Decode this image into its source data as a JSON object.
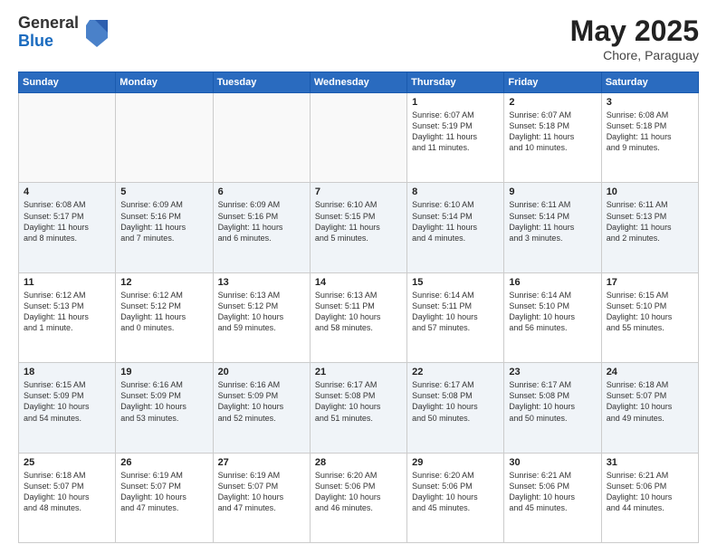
{
  "header": {
    "logo_general": "General",
    "logo_blue": "Blue",
    "month": "May 2025",
    "location": "Chore, Paraguay"
  },
  "weekdays": [
    "Sunday",
    "Monday",
    "Tuesday",
    "Wednesday",
    "Thursday",
    "Friday",
    "Saturday"
  ],
  "weeks": [
    [
      {
        "day": "",
        "info": "",
        "empty": true
      },
      {
        "day": "",
        "info": "",
        "empty": true
      },
      {
        "day": "",
        "info": "",
        "empty": true
      },
      {
        "day": "",
        "info": "",
        "empty": true
      },
      {
        "day": "1",
        "info": "Sunrise: 6:07 AM\nSunset: 5:19 PM\nDaylight: 11 hours\nand 11 minutes."
      },
      {
        "day": "2",
        "info": "Sunrise: 6:07 AM\nSunset: 5:18 PM\nDaylight: 11 hours\nand 10 minutes."
      },
      {
        "day": "3",
        "info": "Sunrise: 6:08 AM\nSunset: 5:18 PM\nDaylight: 11 hours\nand 9 minutes."
      }
    ],
    [
      {
        "day": "4",
        "info": "Sunrise: 6:08 AM\nSunset: 5:17 PM\nDaylight: 11 hours\nand 8 minutes."
      },
      {
        "day": "5",
        "info": "Sunrise: 6:09 AM\nSunset: 5:16 PM\nDaylight: 11 hours\nand 7 minutes."
      },
      {
        "day": "6",
        "info": "Sunrise: 6:09 AM\nSunset: 5:16 PM\nDaylight: 11 hours\nand 6 minutes."
      },
      {
        "day": "7",
        "info": "Sunrise: 6:10 AM\nSunset: 5:15 PM\nDaylight: 11 hours\nand 5 minutes."
      },
      {
        "day": "8",
        "info": "Sunrise: 6:10 AM\nSunset: 5:14 PM\nDaylight: 11 hours\nand 4 minutes."
      },
      {
        "day": "9",
        "info": "Sunrise: 6:11 AM\nSunset: 5:14 PM\nDaylight: 11 hours\nand 3 minutes."
      },
      {
        "day": "10",
        "info": "Sunrise: 6:11 AM\nSunset: 5:13 PM\nDaylight: 11 hours\nand 2 minutes."
      }
    ],
    [
      {
        "day": "11",
        "info": "Sunrise: 6:12 AM\nSunset: 5:13 PM\nDaylight: 11 hours\nand 1 minute."
      },
      {
        "day": "12",
        "info": "Sunrise: 6:12 AM\nSunset: 5:12 PM\nDaylight: 11 hours\nand 0 minutes."
      },
      {
        "day": "13",
        "info": "Sunrise: 6:13 AM\nSunset: 5:12 PM\nDaylight: 10 hours\nand 59 minutes."
      },
      {
        "day": "14",
        "info": "Sunrise: 6:13 AM\nSunset: 5:11 PM\nDaylight: 10 hours\nand 58 minutes."
      },
      {
        "day": "15",
        "info": "Sunrise: 6:14 AM\nSunset: 5:11 PM\nDaylight: 10 hours\nand 57 minutes."
      },
      {
        "day": "16",
        "info": "Sunrise: 6:14 AM\nSunset: 5:10 PM\nDaylight: 10 hours\nand 56 minutes."
      },
      {
        "day": "17",
        "info": "Sunrise: 6:15 AM\nSunset: 5:10 PM\nDaylight: 10 hours\nand 55 minutes."
      }
    ],
    [
      {
        "day": "18",
        "info": "Sunrise: 6:15 AM\nSunset: 5:09 PM\nDaylight: 10 hours\nand 54 minutes."
      },
      {
        "day": "19",
        "info": "Sunrise: 6:16 AM\nSunset: 5:09 PM\nDaylight: 10 hours\nand 53 minutes."
      },
      {
        "day": "20",
        "info": "Sunrise: 6:16 AM\nSunset: 5:09 PM\nDaylight: 10 hours\nand 52 minutes."
      },
      {
        "day": "21",
        "info": "Sunrise: 6:17 AM\nSunset: 5:08 PM\nDaylight: 10 hours\nand 51 minutes."
      },
      {
        "day": "22",
        "info": "Sunrise: 6:17 AM\nSunset: 5:08 PM\nDaylight: 10 hours\nand 50 minutes."
      },
      {
        "day": "23",
        "info": "Sunrise: 6:17 AM\nSunset: 5:08 PM\nDaylight: 10 hours\nand 50 minutes."
      },
      {
        "day": "24",
        "info": "Sunrise: 6:18 AM\nSunset: 5:07 PM\nDaylight: 10 hours\nand 49 minutes."
      }
    ],
    [
      {
        "day": "25",
        "info": "Sunrise: 6:18 AM\nSunset: 5:07 PM\nDaylight: 10 hours\nand 48 minutes."
      },
      {
        "day": "26",
        "info": "Sunrise: 6:19 AM\nSunset: 5:07 PM\nDaylight: 10 hours\nand 47 minutes."
      },
      {
        "day": "27",
        "info": "Sunrise: 6:19 AM\nSunset: 5:07 PM\nDaylight: 10 hours\nand 47 minutes."
      },
      {
        "day": "28",
        "info": "Sunrise: 6:20 AM\nSunset: 5:06 PM\nDaylight: 10 hours\nand 46 minutes."
      },
      {
        "day": "29",
        "info": "Sunrise: 6:20 AM\nSunset: 5:06 PM\nDaylight: 10 hours\nand 45 minutes."
      },
      {
        "day": "30",
        "info": "Sunrise: 6:21 AM\nSunset: 5:06 PM\nDaylight: 10 hours\nand 45 minutes."
      },
      {
        "day": "31",
        "info": "Sunrise: 6:21 AM\nSunset: 5:06 PM\nDaylight: 10 hours\nand 44 minutes."
      }
    ]
  ]
}
